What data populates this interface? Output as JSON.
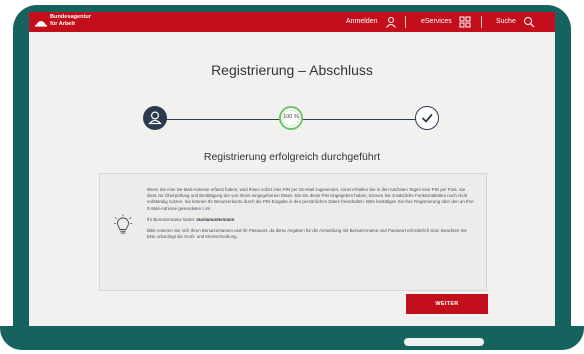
{
  "header": {
    "brand_line1": "Bundesagentur",
    "brand_line2": "für Arbeit",
    "login_label": "Anmelden",
    "eservices_label": "eServices",
    "search_label": "Suche",
    "accent_color": "#c30f1c",
    "icons": [
      "logo-icon",
      "user-icon",
      "grid-icon",
      "search-icon"
    ]
  },
  "page": {
    "title": "Registrierung – Abschluss",
    "success_heading": "Registrierung erfolgreich durchgeführt"
  },
  "steps": {
    "icons": [
      "user-icon",
      "progress-ring",
      "checkmark-icon"
    ],
    "progress_label": "100 %",
    "progress_value": 1.0,
    "progress_color": "#6fc36a"
  },
  "info": {
    "icon": "lightbulb-icon",
    "paragraph1_main": "Wenn Sie eine De-Mail-Adresse erfasst haben, wird Ihnen sofort eine PIN per De-Mail zugesendet, sonst erhalten Sie in den nächsten Tagen eine PIN per Post. Sie dient zur Überprüfung und Bestätigung der von Ihnen eingegebenen Daten. Bis Sie diese PIN eingegeben haben, können Sie zusätzliche Funktionalitäten noch nicht vollständig nutzen. Sie können Ihr Benutzerkonto durch die PIN-Eingabe in den persönlichen Daten freischalten. Bitte bestätigen Sie Ihre Registrierung über den an Ihre E-Mail-Adresse gesendeten",
    "paragraph1_link": "Link",
    "username_prefix": "Ihr Benutzername lautet:",
    "username": "mariamustermann",
    "paragraph3": "Bitte notieren Sie sich Ihren Benutzernamen und Ihr Passwort, da diese Angaben für die Anmeldung mit Benutzername und Passwort erforderlich sind. Beachten Sie bitte unbedingt die Groß- und Kleinschreibung."
  },
  "actions": {
    "next_label": "WEITER"
  }
}
